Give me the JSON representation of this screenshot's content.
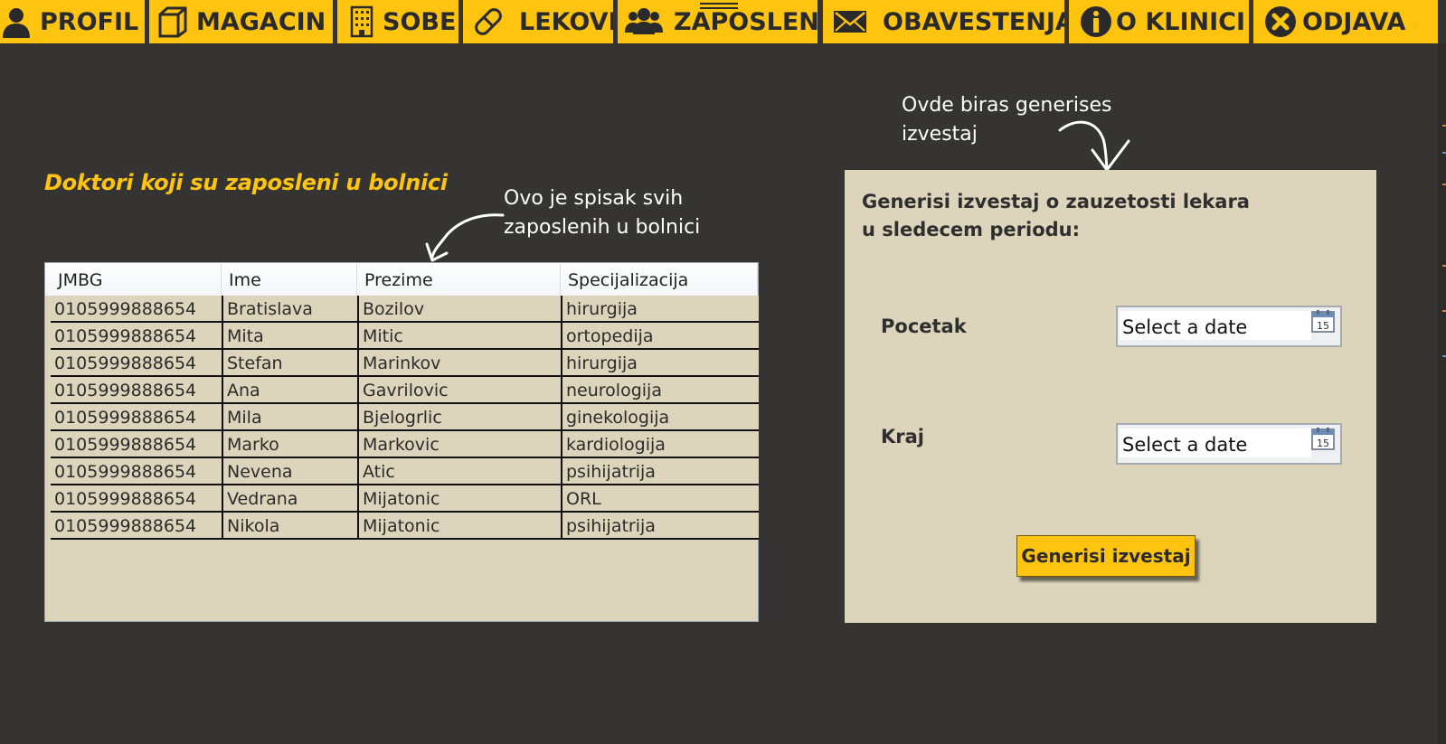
{
  "nav": {
    "items": [
      {
        "label": "PROFIL",
        "icon": "user-icon"
      },
      {
        "label": "MAGACIN",
        "icon": "box-icon"
      },
      {
        "label": "SOBE",
        "icon": "building-icon"
      },
      {
        "label": "LEKOVI",
        "icon": "pill-icon"
      },
      {
        "label": "ZAPOSLENI",
        "icon": "people-icon"
      },
      {
        "label": "OBAVESTENJA",
        "icon": "envelope-icon"
      },
      {
        "label": "O KLINICI",
        "icon": "info-icon"
      },
      {
        "label": "ODJAVA",
        "icon": "close-circle-icon"
      }
    ]
  },
  "doctors": {
    "title": "Doktori koji su zaposleni u bolnici",
    "note": [
      "Ovo je spisak svih",
      "zaposlenih u bolnici"
    ],
    "columns": [
      "JMBG",
      "Ime",
      "Prezime",
      "Specijalizacija"
    ],
    "rows": [
      [
        "0105999888654",
        "Bratislava",
        "Bozilov",
        "hirurgija"
      ],
      [
        "0105999888654",
        "Mita",
        "Mitic",
        "ortopedija"
      ],
      [
        "0105999888654",
        "Stefan",
        "Marinkov",
        "hirurgija"
      ],
      [
        "0105999888654",
        "Ana",
        "Gavrilovic",
        "neurologija"
      ],
      [
        "0105999888654",
        "Mila",
        "Bjelogrlic",
        "ginekologija"
      ],
      [
        "0105999888654",
        "Marko",
        "Markovic",
        "kardiologija"
      ],
      [
        "0105999888654",
        "Nevena",
        "Atic",
        "psihijatrija"
      ],
      [
        "0105999888654",
        "Vedrana",
        "Mijatonic",
        "ORL"
      ],
      [
        "0105999888654",
        "Nikola",
        "Mijatonic",
        "psihijatrija"
      ]
    ]
  },
  "report": {
    "note": [
      "Ovde biras generises",
      "izvestaj"
    ],
    "title": "Generisi izvestaj o zauzetosti lekara u sledecem periodu:",
    "start_label": "Pocetak",
    "end_label": "Kraj",
    "date_placeholder": "Select a date",
    "calendar_day": "15",
    "button_label": "Generisi izvestaj"
  },
  "colors": {
    "accent": "#ffc40f",
    "background": "#353432",
    "panel": "#ddd5bb"
  }
}
